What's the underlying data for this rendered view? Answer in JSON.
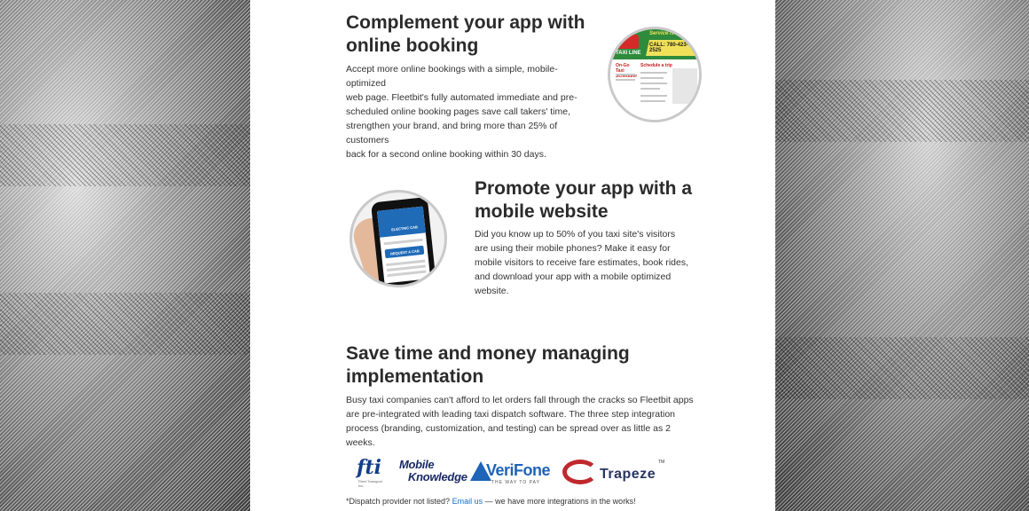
{
  "sections": {
    "booking": {
      "title_line1": "Complement your app with",
      "title_line2": "online booking",
      "body_lines": [
        "Accept more online bookings with a simple, mobile-optimized",
        "web page. Fleetbit's fully automated immediate and pre-",
        "scheduled online booking pages save call takers' time,",
        "strengthen your brand, and bring more than 25% of customers",
        "back for a second online booking within 30 days."
      ],
      "screenshot": {
        "service_text": "Service is Our",
        "phone_text": "CALL: 780-423-2525",
        "brand_text": "TAXI LINE",
        "left_label": "On-Go Taxi Scheduler",
        "right_label": "Schedule a trip"
      }
    },
    "mobile": {
      "title_line1": "Promote your app with a",
      "title_line2": "mobile website",
      "body_lines": [
        "Did you know up to 50% of you taxi site's visitors",
        "are using their mobile phones? Make it easy for",
        "mobile visitors to receive fare estimates, book rides,",
        "and download your app with a mobile optimized",
        "website."
      ],
      "phone": {
        "brand_text": "ELECTRIC CAB",
        "button_text": "REQUEST A CAB"
      }
    },
    "implementation": {
      "title_line1": "Save time and money managing",
      "title_line2": "implementation",
      "body_lines": [
        "Busy taxi companies can't afford to let orders fall through the cracks so Fleetbit apps",
        "are pre-integrated with leading taxi dispatch software. The three step integration",
        "process (branding, customization, and testing) can be spread over as little as 2",
        "weeks."
      ]
    }
  },
  "logos": {
    "fti": {
      "mark": "fti",
      "sub": "Fleet Transport Inc."
    },
    "mobile_knowledge": {
      "line1": "Mobile",
      "line2": "Knowledge"
    },
    "verifone": {
      "name": "VeriFone",
      "tagline": "THE WAY TO PAY"
    },
    "trapeze": {
      "name": "Trapeze",
      "tm": "TM"
    }
  },
  "footer": {
    "prefix": "*Dispatch provider not listed?",
    "link": "Email us",
    "suffix": "— we have more integrations in the works!"
  },
  "colors": {
    "heading": "#2b2b2b",
    "link": "#1a6fc5",
    "taxi_green": "#2e8b3b",
    "brand_blue": "#1f6bb8"
  }
}
